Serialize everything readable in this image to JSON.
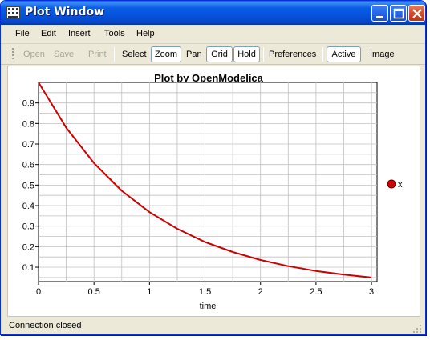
{
  "window": {
    "title": "Plot Window"
  },
  "menu": {
    "items": [
      "File",
      "Edit",
      "Insert",
      "Tools",
      "Help"
    ]
  },
  "toolbar": {
    "open": "Open",
    "save": "Save",
    "print": "Print",
    "select": "Select",
    "zoom": "Zoom",
    "pan": "Pan",
    "grid": "Grid",
    "hold": "Hold",
    "preferences": "Preferences",
    "active": "Active",
    "image": "Image"
  },
  "status": {
    "text": "Connection closed"
  },
  "colors": {
    "series": "#cc0000",
    "grid": "#c0c0c0",
    "title_bar": "#0653dc"
  },
  "chart_data": {
    "type": "line",
    "title": "Plot by OpenModelica",
    "xlabel": "time",
    "ylabel": "",
    "xlim": [
      0,
      3.05
    ],
    "ylim": [
      0.03,
      1.0
    ],
    "xticks": [
      0,
      0.5,
      1,
      1.5,
      2,
      2.5,
      3
    ],
    "xtick_labels": [
      "0",
      "0.5",
      "1",
      "1.5",
      "2",
      "2.5",
      "3"
    ],
    "yticks": [
      0.1,
      0.2,
      0.3,
      0.4,
      0.5,
      0.6,
      0.7,
      0.8,
      0.9
    ],
    "ytick_labels": [
      "0.1",
      "0.2",
      "0.3",
      "0.4",
      "0.5",
      "0.6",
      "0.7",
      "0.8",
      "0.9"
    ],
    "grid": true,
    "legend_position": "right",
    "series": [
      {
        "name": "x",
        "color": "#cc0000",
        "x": [
          0,
          0.25,
          0.5,
          0.75,
          1.0,
          1.25,
          1.5,
          1.75,
          2.0,
          2.25,
          2.5,
          2.75,
          3.0
        ],
        "y": [
          1.0,
          0.779,
          0.607,
          0.472,
          0.368,
          0.287,
          0.223,
          0.174,
          0.135,
          0.105,
          0.082,
          0.064,
          0.05
        ]
      }
    ]
  }
}
